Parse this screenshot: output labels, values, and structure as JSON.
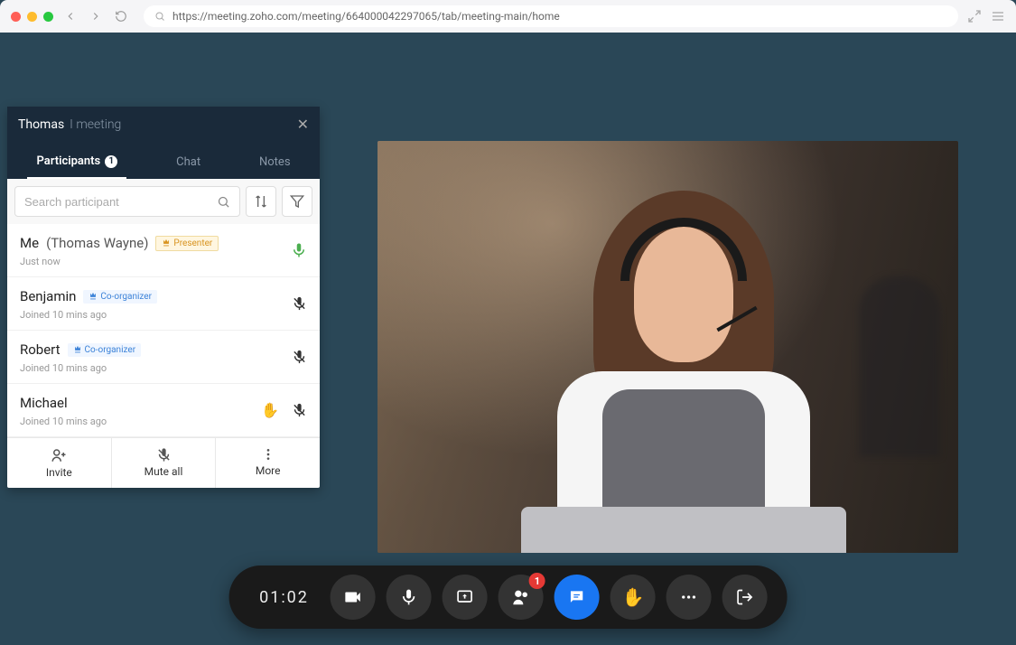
{
  "browser": {
    "url": "https://meeting.zoho.com/meeting/664000042297065/tab/meeting-main/home"
  },
  "panel": {
    "title_prefix": "Thomas",
    "title_suffix": "I meeting",
    "tabs": {
      "participants": "Participants",
      "participants_count": "1",
      "chat": "Chat",
      "notes": "Notes"
    },
    "search": {
      "placeholder": "Search participant"
    },
    "participants": [
      {
        "name": "Me",
        "name_sub": "(Thomas Wayne)",
        "badge": "Presenter",
        "time": "Just now",
        "mic": "active"
      },
      {
        "name": "Benjamin",
        "name_sub": "",
        "badge": "Co-organizer",
        "time": "Joined 10 mins ago",
        "mic": "muted"
      },
      {
        "name": "Robert",
        "name_sub": "",
        "badge": "Co-organizer",
        "time": "Joined 10 mins ago",
        "mic": "muted"
      },
      {
        "name": "Michael",
        "name_sub": "",
        "badge": "",
        "time": "Joined 10 mins ago",
        "mic": "muted",
        "hand": true
      }
    ],
    "footer": {
      "invite": "Invite",
      "mute_all": "Mute all",
      "more": "More"
    }
  },
  "toolbar": {
    "timer": "01:02",
    "participants_badge": "1"
  }
}
